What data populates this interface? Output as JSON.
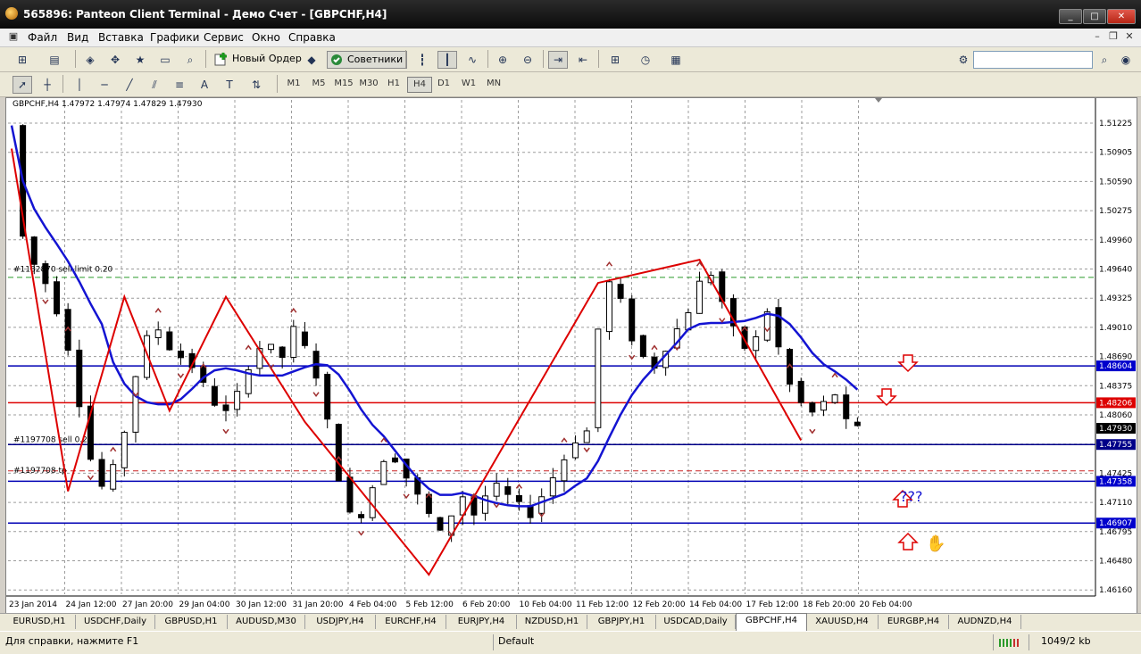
{
  "window": {
    "title": "565896: Panteon Client Terminal - Демо Счет - [GBPCHF,H4]",
    "controls": [
      "_",
      "□",
      "✕"
    ]
  },
  "menu": [
    "Файл",
    "Вид",
    "Вставка",
    "Графики",
    "Сервис",
    "Окно",
    "Справка"
  ],
  "toolbar": {
    "new_order": "Новый Ордер",
    "experts": "Советники"
  },
  "timeframes": [
    "M1",
    "M5",
    "M15",
    "M30",
    "H1",
    "H4",
    "D1",
    "W1",
    "MN"
  ],
  "active_timeframe": "H4",
  "chart": {
    "header": "GBPCHF,H4  1.47972 1.47974 1.47829 1.47930",
    "price_labels": [
      "1.51225",
      "1.50905",
      "1.50590",
      "1.50275",
      "1.49960",
      "1.49640",
      "1.49325",
      "1.49010",
      "1.48690",
      "1.48375",
      "1.48060",
      "1.47745",
      "1.47425",
      "1.47110",
      "1.46795",
      "1.46480",
      "1.46160"
    ],
    "highlighted_prices": [
      {
        "value": "1.48604",
        "color": "#0000cc"
      },
      {
        "value": "1.48206",
        "color": "#dd0000"
      },
      {
        "value": "1.47930",
        "color": "#000000"
      },
      {
        "value": "1.47755",
        "color": "#000088"
      },
      {
        "value": "1.47358",
        "color": "#0000cc"
      },
      {
        "value": "1.46907",
        "color": "#0000cc"
      }
    ],
    "time_labels": [
      "23 Jan 2014",
      "24 Jan 12:00",
      "27 Jan 20:00",
      "29 Jan 04:00",
      "30 Jan 12:00",
      "31 Jan 20:00",
      "4 Feb 04:00",
      "5 Feb 12:00",
      "6 Feb 20:00",
      "10 Feb 04:00",
      "11 Feb 12:00",
      "12 Feb 20:00",
      "14 Feb 04:00",
      "17 Feb 12:00",
      "18 Feb 20:00",
      "20 Feb 04:00"
    ],
    "order_labels": [
      "#1182870 sell limit 0.20",
      "#1197708 sell 0.20",
      "#1197708 tp"
    ],
    "annotation_text": "???",
    "colors": {
      "ma": "#1414d2",
      "zigzag": "#dd0000",
      "hline_blue": "#0000b4",
      "hline_red": "#dd0000",
      "arrow": "#dd0000",
      "candle": "#000000"
    }
  },
  "tabs": [
    "EURUSD,H1",
    "USDCHF,Daily",
    "GBPUSD,H1",
    "AUDUSD,M30",
    "USDJPY,H4",
    "EURCHF,H4",
    "EURJPY,H4",
    "NZDUSD,H1",
    "GBPJPY,H1",
    "USDCAD,Daily",
    "GBPCHF,H4",
    "XAUUSD,H4",
    "EURGBP,H4",
    "AUDNZD,H4"
  ],
  "active_tab": "GBPCHF,H4",
  "status": {
    "help": "Для справки, нажмите F1",
    "profile": "Default",
    "traffic": "1049/2 kb"
  }
}
